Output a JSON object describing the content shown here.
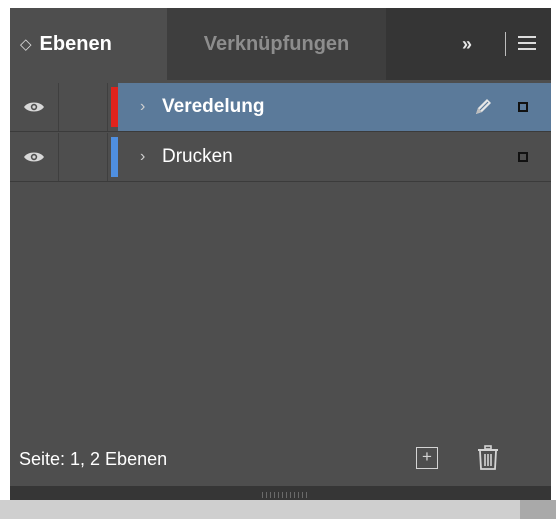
{
  "tabs": [
    {
      "label": "Ebenen",
      "active": true
    },
    {
      "label": "Verknüpfungen",
      "active": false
    }
  ],
  "tab_sort_icon": "updown-arrows-icon",
  "overflow_label": "››",
  "accent": {
    "selection_bg": "#5b7a9a",
    "layer1_color": "#e0231c",
    "layer2_color": "#4f8fe0"
  },
  "layers": [
    {
      "name": "Veredelung",
      "selected": true,
      "expand": "›",
      "has_pen": true
    },
    {
      "name": "Drucken",
      "selected": false,
      "expand": "›",
      "has_pen": false
    }
  ],
  "footer": {
    "status": "Seite: 1, 2 Ebenen",
    "new_layer_icon": "plus-box-icon",
    "delete_icon": "trash-icon"
  }
}
